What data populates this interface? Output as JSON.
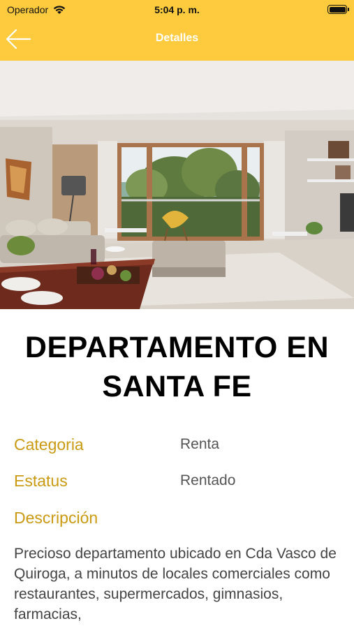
{
  "status_bar": {
    "carrier": "Operador",
    "time": "5:04 p. m.",
    "battery_level": 1.0
  },
  "nav": {
    "title": "Detalles",
    "back_icon": "arrow-left-icon"
  },
  "property": {
    "title": "DEPARTAMENTO EN SANTA FE",
    "category_label": "Categoria",
    "category_value": "Renta",
    "status_label": "Estatus",
    "status_value": "Rentado",
    "description_label": "Descripción",
    "description": "Precioso departamento ubicado en Cda Vasco de Quiroga, a minutos de locales comerciales como restaurantes, supermercados, gimnasios, farmacias,"
  },
  "colors": {
    "header": "#FDCB3D",
    "label_accent": "#C99A12",
    "title_text": "#000000"
  }
}
